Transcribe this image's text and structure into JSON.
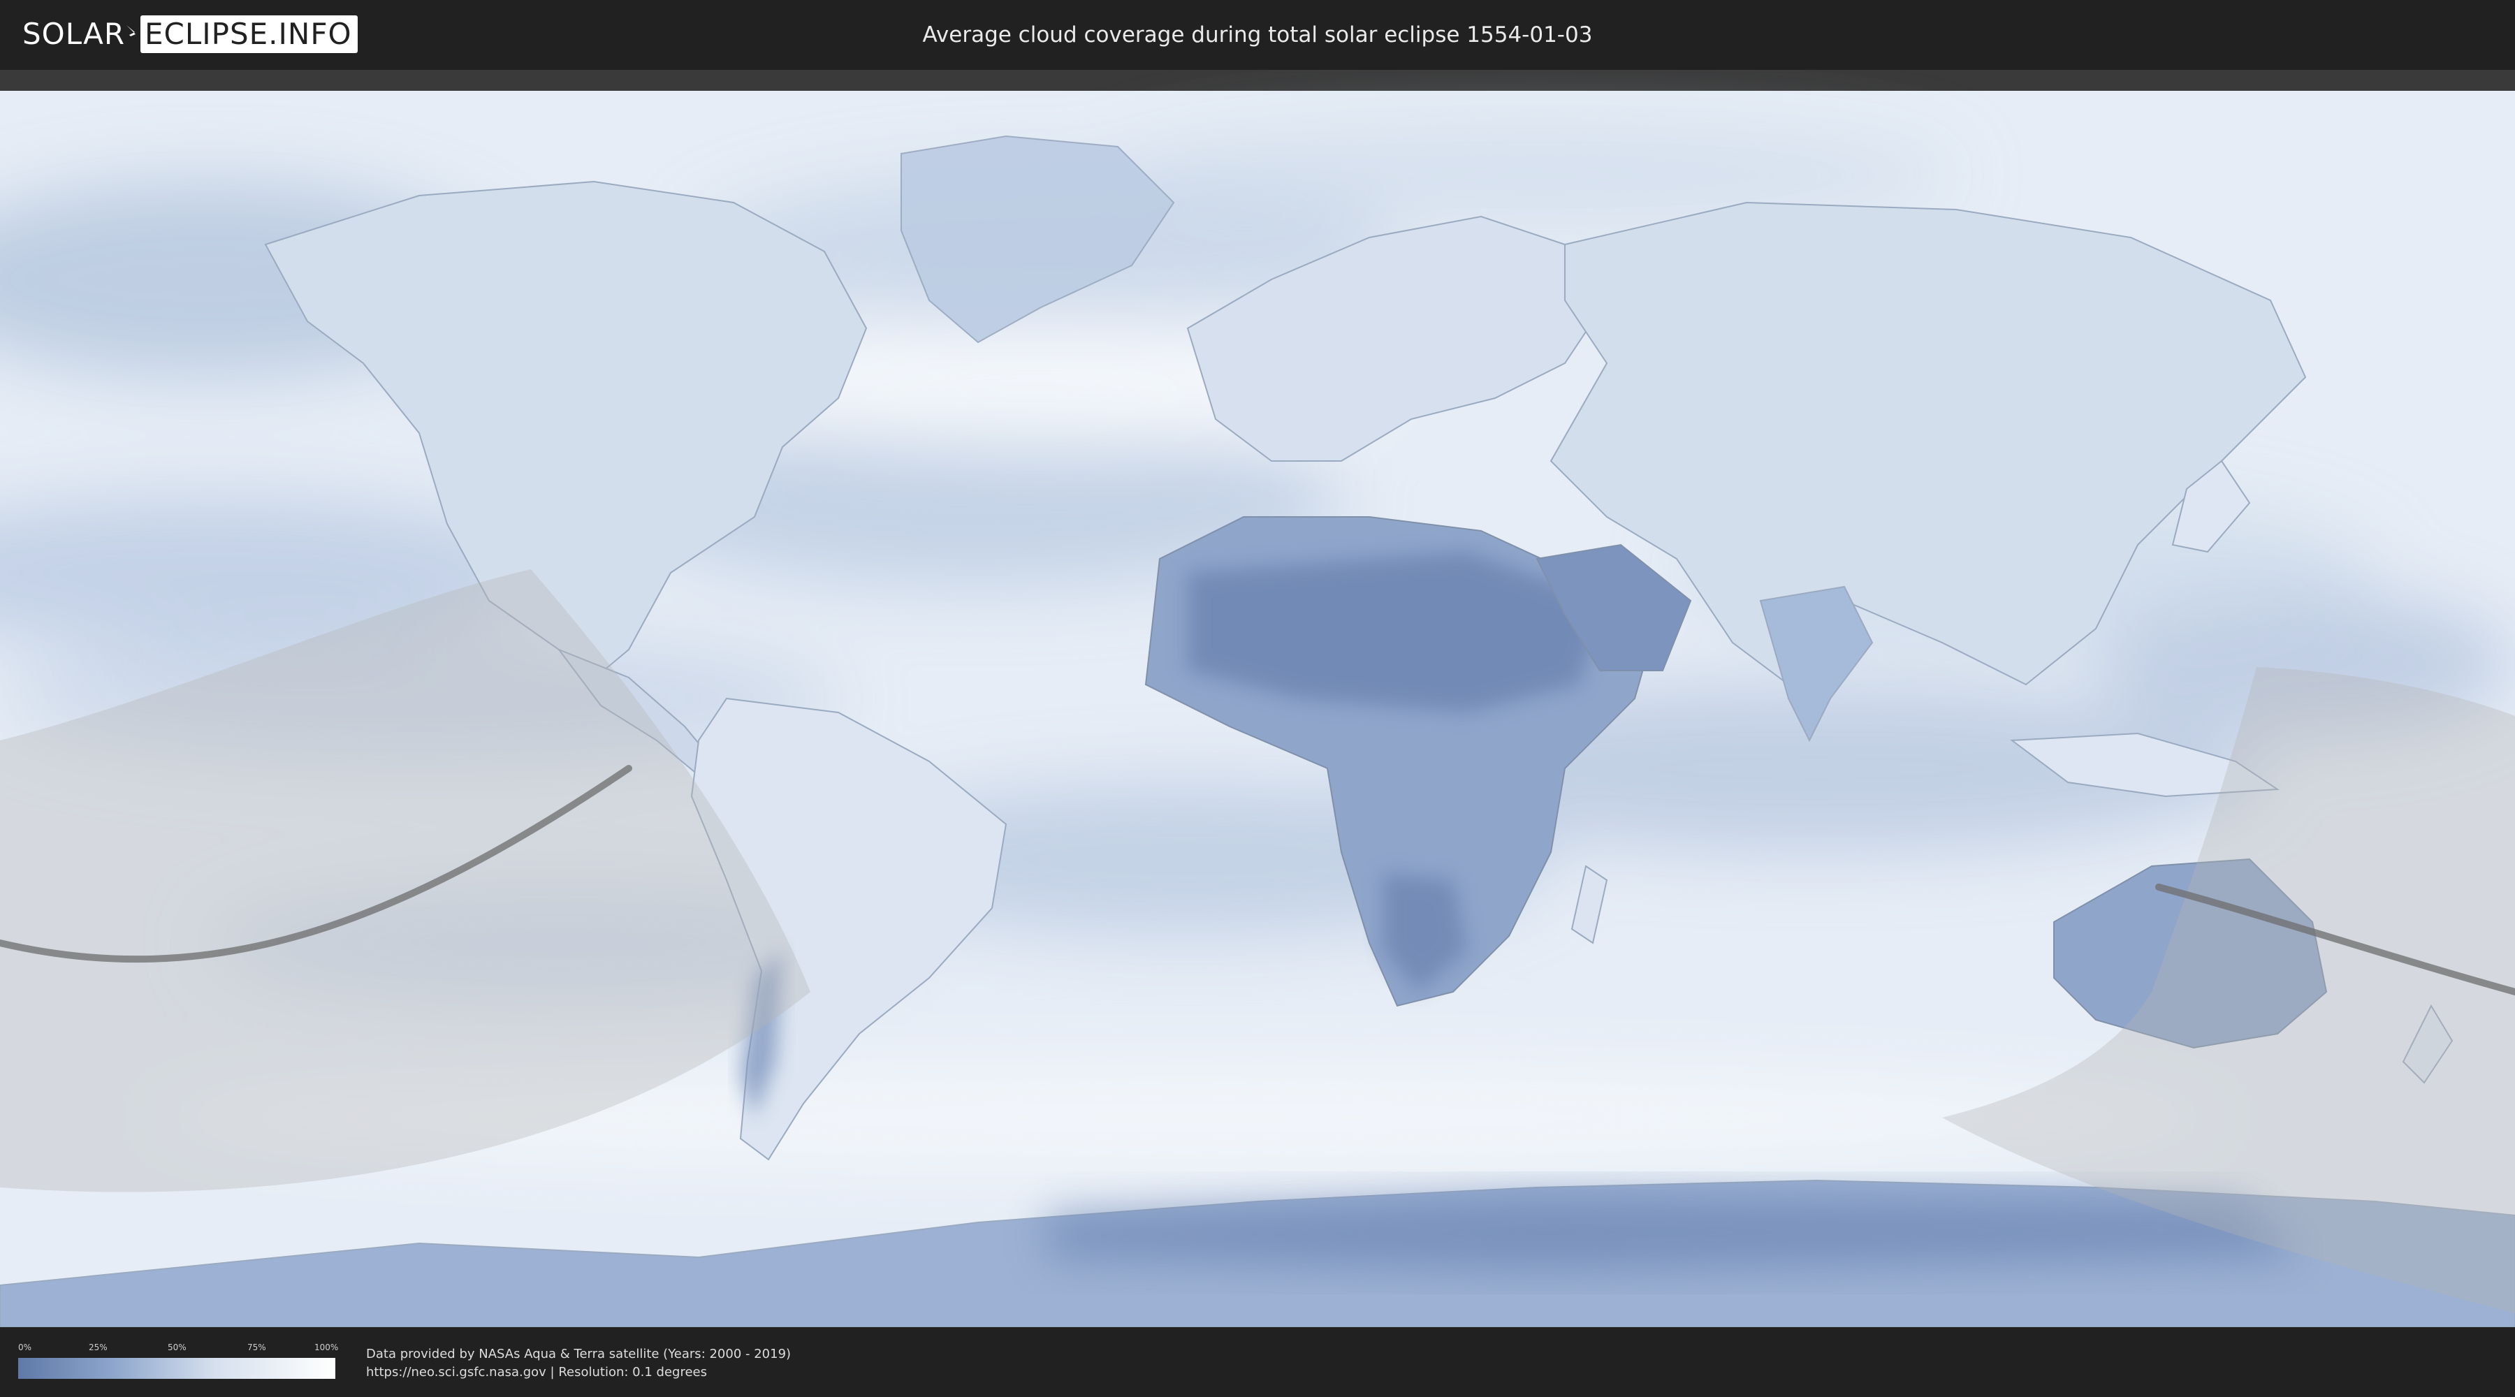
{
  "header": {
    "logo": {
      "left": "SOLAR",
      "right": "ECLIPSE.INFO"
    },
    "title": "Average cloud coverage during total solar eclipse 1554-01-03"
  },
  "map": {
    "ocean_color": "#e6edf6",
    "clear_sky_color": "#5f79a8",
    "shadow_color": "#b4b4b4"
  },
  "legend": {
    "ticks": [
      "0%",
      "25%",
      "50%",
      "75%",
      "100%"
    ],
    "colors": [
      "#5f79a8",
      "#ffffff"
    ]
  },
  "footer": {
    "credit_line1": "Data provided by NASAs Aqua & Terra satellite (Years: 2000 - 2019)",
    "credit_line2": "https://neo.sci.gsfc.nasa.gov | Resolution: 0.1 degrees"
  }
}
